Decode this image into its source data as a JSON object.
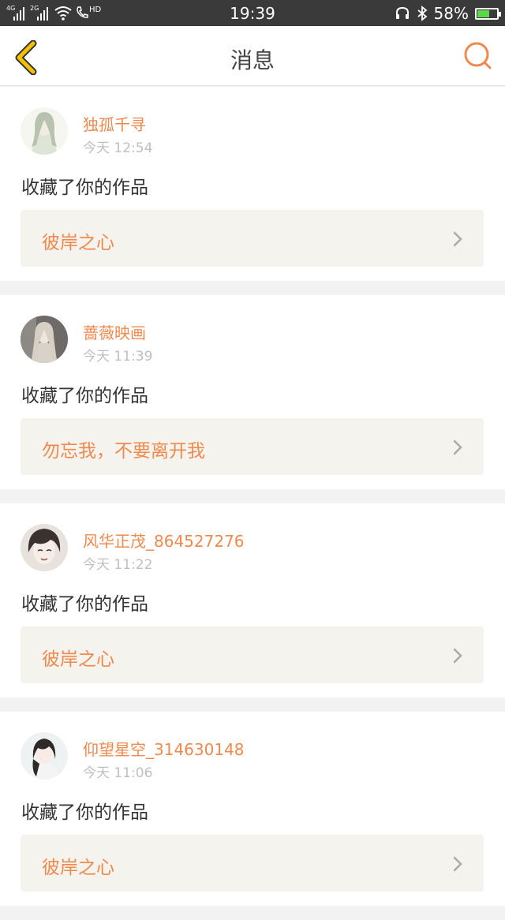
{
  "status_bar": {
    "net1": "4G",
    "net2": "2G",
    "call_badge": "HD",
    "time": "19:39",
    "battery_text": "58%",
    "battery_level": 0.58
  },
  "header": {
    "title": "消息",
    "back_icon": "chevron-left-icon",
    "search_icon": "search-icon"
  },
  "colors": {
    "accent": "#ef8a4f",
    "back_icon": "#f2c200",
    "background": "#f2f2f2",
    "card_bg": "#ffffff",
    "work_bg": "#f4f3ee"
  },
  "messages": [
    {
      "name": "独孤千寻",
      "time": "今天 12:54",
      "action": "收藏了你的作品",
      "work_title": "彼岸之心"
    },
    {
      "name": "蔷薇映画",
      "time": "今天 11:39",
      "action": "收藏了你的作品",
      "work_title": "勿忘我，不要离开我"
    },
    {
      "name": "风华正茂_864527276",
      "time": "今天 11:22",
      "action": "收藏了你的作品",
      "work_title": "彼岸之心"
    },
    {
      "name": "仰望星空_314630148",
      "time": "今天 11:06",
      "action": "收藏了你的作品",
      "work_title": "彼岸之心"
    }
  ]
}
